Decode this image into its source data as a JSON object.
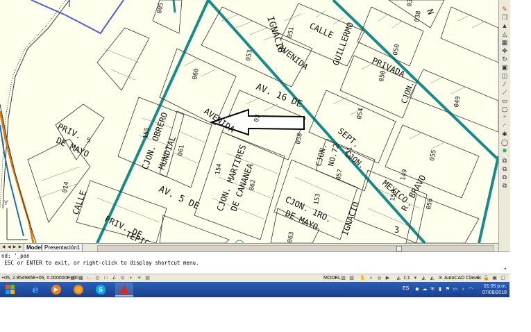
{
  "map": {
    "labels": {
      "b005": "005",
      "ignacio": "IGNACIO",
      "b039": "039",
      "n_zn": "N",
      "calle": "CALLE",
      "b051": "051",
      "guillermo": "GUILLERMO",
      "b038": "038",
      "b053": "053",
      "avenida1": "AVENIDA",
      "b050a": "050",
      "privada": "PRIVADA",
      "b050b": "050",
      "b060": "060",
      "av16de": "AV. 16 DE",
      "avenida2": "AVENIDA",
      "b03": "03",
      "cjon_ne": "CJON.",
      "b049": "049",
      "b054": "054",
      "priv_de": "PRIV.",
      "de_mayo": "DE MAYO",
      "b155": "155",
      "b061": "061",
      "cjon_obrero": "CJON. OBRERO",
      "mundial": "MUNDIAL",
      "b058": "058",
      "sept": "SEPT.",
      "cjon_no": "CJON.",
      "no72": "NO.72",
      "b151": "151",
      "cjon_b": "CJON.",
      "b057": "057",
      "b055": "055",
      "b154": "154",
      "cjon_martires": "CJON. MARTIRES",
      "de_cananea": "DE CANANEA",
      "b062": "062",
      "b014": "014",
      "av5de": "AV. 5 DE",
      "calle2": "CALLE",
      "b149": "149",
      "b150": "150",
      "mexico": "MEXICO",
      "b153": "153",
      "cjon_1ro": "CJON. 1RO.",
      "de_mayo2": "DE MAYO",
      "ignacio2": "IGNACIO",
      "b056": "056",
      "bravo": "R. BRAVO",
      "priv_de2": "PRIV. DE",
      "tepic": "TEPIC",
      "b063": "063",
      "b3": "3",
      "b5": "5"
    },
    "colors": {
      "paper": "#ffffee",
      "avenue": "#168b88",
      "lot": "#333333",
      "rail": "#e07a10",
      "blueline": "#4b5fd6",
      "rail2": "#1f6ea8"
    }
  },
  "tabs": {
    "model": "Model",
    "layout1": "Presentación1"
  },
  "command": {
    "line1": "nd: '_pan",
    "line2": " ESC or ENTER to exit, or right-click to display shortcut menu."
  },
  "status": {
    "coords": "+05, 2.854985E+06, 0.000000E+00",
    "model": "MODEL",
    "scale": "1:1",
    "workspace": "AutoCAD Classic"
  },
  "taskbar": {
    "lang": "ES",
    "time": "01:05 p.m.",
    "date": "07/08/2018"
  }
}
